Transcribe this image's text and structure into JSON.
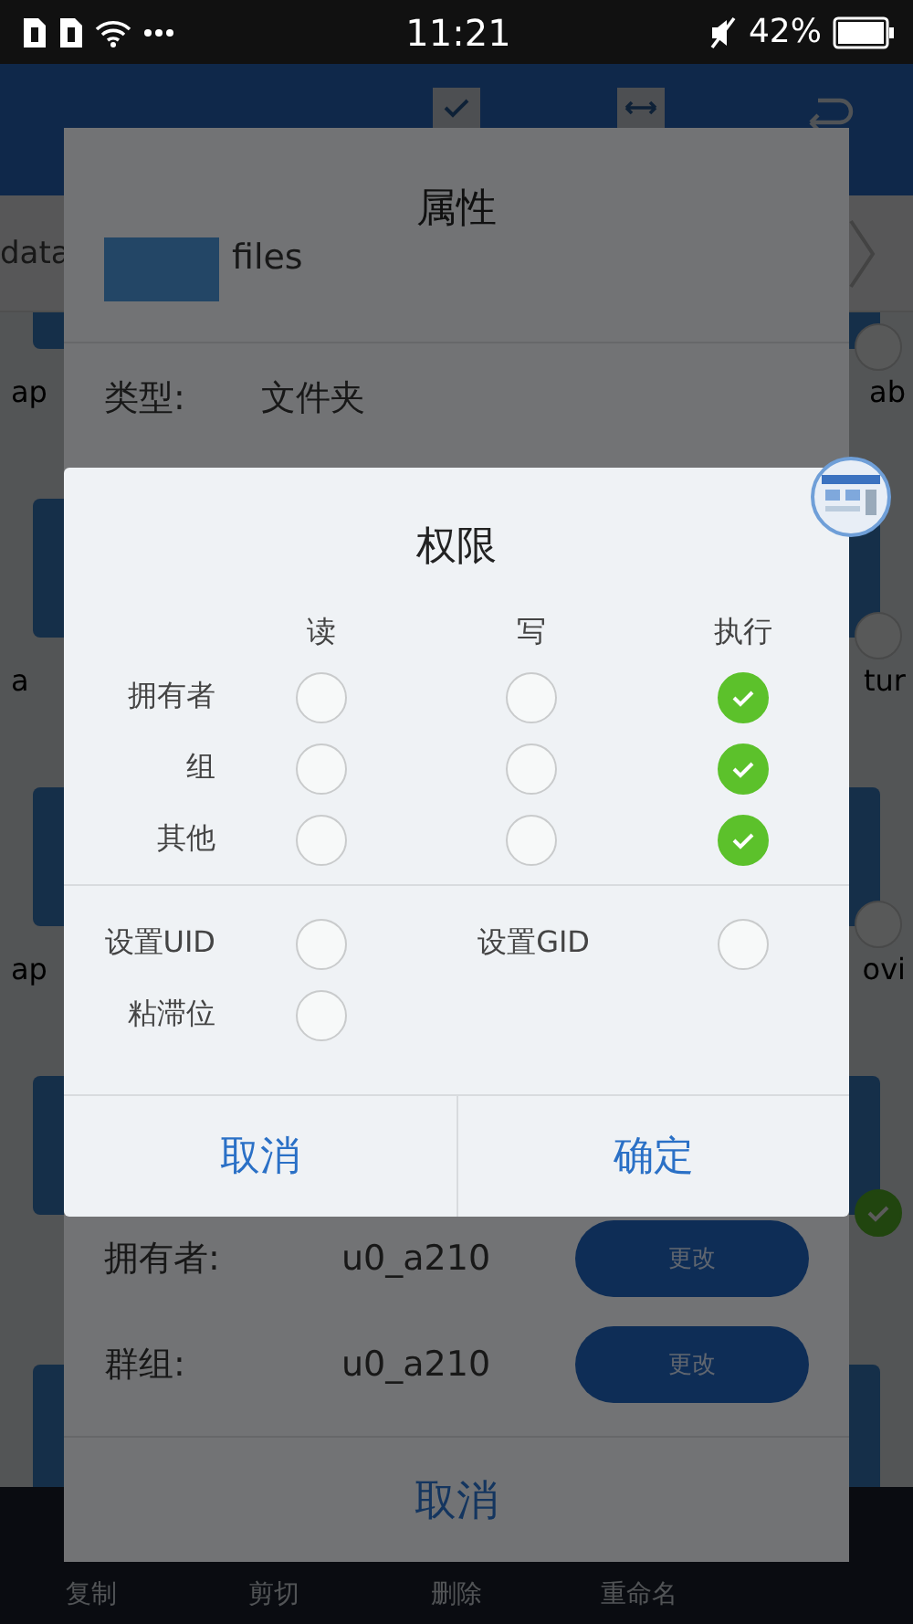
{
  "status_bar": {
    "time": "11:21",
    "battery": "42%"
  },
  "breadcrumb": {
    "segment": "data"
  },
  "grid_rows": [
    {
      "left_label": "ap",
      "right_label": "ab",
      "right_checked": false
    },
    {
      "left_label": "a",
      "right_label": "tur",
      "right_checked": false
    },
    {
      "left_label": "ap",
      "right_label": "ovi",
      "right_checked": false
    },
    {
      "right_checked": true
    },
    {}
  ],
  "bottom_bar": [
    "复制",
    "剪切",
    "删除",
    "重命名"
  ],
  "properties_dialog": {
    "title": "属性",
    "name": "files",
    "fields": [
      {
        "label": "类型:",
        "value": "文件夹"
      }
    ],
    "owner_rows": [
      {
        "label": "拥有者:",
        "value": "u0_a210",
        "button": "更改"
      },
      {
        "label": "群组:",
        "value": "u0_a210",
        "button": "更改"
      }
    ],
    "cancel": "取消"
  },
  "permissions_dialog": {
    "title": "权限",
    "columns": [
      "读",
      "写",
      "执行"
    ],
    "rows": [
      {
        "label": "拥有者",
        "checks": [
          {
            "checked": false
          },
          {
            "checked": false
          },
          {
            "checked": true
          }
        ]
      },
      {
        "label": "组",
        "checks": [
          {
            "checked": false
          },
          {
            "checked": false
          },
          {
            "checked": true
          }
        ]
      },
      {
        "label": "其他",
        "checks": [
          {
            "checked": false
          },
          {
            "checked": false
          },
          {
            "checked": true
          }
        ]
      }
    ],
    "special": [
      {
        "label": "设置UID",
        "checked": false
      },
      {
        "label": "设置GID",
        "checked": false
      },
      {
        "label": "粘滞位",
        "checked": false
      }
    ],
    "buttons": [
      "取消",
      "确定"
    ]
  }
}
